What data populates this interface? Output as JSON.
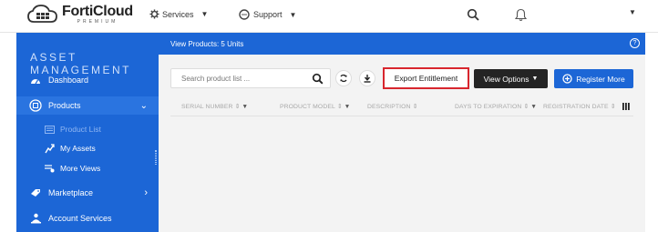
{
  "header": {
    "logo_name": "FortiCloud",
    "logo_sub": "PREMIUM",
    "services_label": "Services",
    "support_label": "Support",
    "icons": [
      "cloud-logo-icon",
      "services-gear-icon",
      "support-chat-icon",
      "search-icon",
      "bell-icon",
      "caret-down-icon"
    ]
  },
  "sidebar": {
    "title": "ASSET MANAGEMENT",
    "items": [
      {
        "label": "Dashboard",
        "icon": "dashboard-gauge-icon"
      },
      {
        "label": "Products",
        "icon": "products-circle-icon",
        "expanded": true
      },
      {
        "label": "Marketplace",
        "icon": "marketplace-tag-icon"
      },
      {
        "label": "Account Services",
        "icon": "account-users-icon"
      }
    ],
    "sub_items": [
      {
        "label": "Product List",
        "icon": "list-icon",
        "active": true
      },
      {
        "label": "My Assets",
        "icon": "assets-icon"
      },
      {
        "label": "More Views",
        "icon": "views-icon"
      }
    ]
  },
  "main": {
    "info_text": "View Products: 5 Units",
    "search_placeholder": "Search product list ...",
    "export_label": "Export Entitlement",
    "view_options_label": "View Options",
    "register_label": "Register More",
    "columns": [
      "SERIAL NUMBER",
      "PRODUCT MODEL",
      "DESCRIPTION",
      "DAYS TO EXPIRATION",
      "REGISTRATION DATE"
    ]
  },
  "colors": {
    "brand_blue": "#1c66d6",
    "export_border": "#d8262e",
    "dark_button": "#242424",
    "content_bg": "#f3f3f3"
  }
}
